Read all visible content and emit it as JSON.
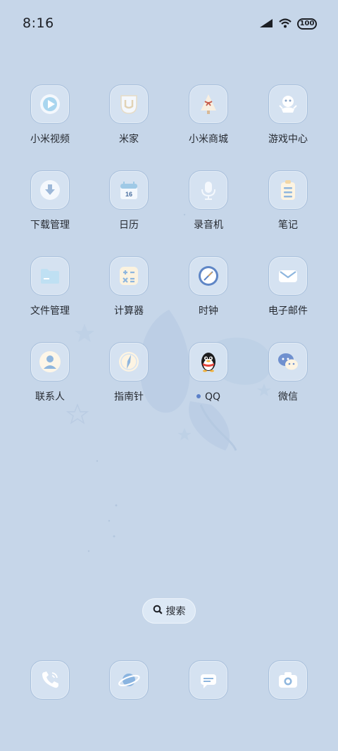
{
  "status_bar": {
    "time": "8:16",
    "battery": "100"
  },
  "apps": [
    {
      "label": "小米视频",
      "icon": "play-icon"
    },
    {
      "label": "米家",
      "icon": "mijia-icon"
    },
    {
      "label": "小米商城",
      "icon": "tree-gift-icon"
    },
    {
      "label": "游戏中心",
      "icon": "game-controller-icon"
    },
    {
      "label": "下载管理",
      "icon": "download-icon"
    },
    {
      "label": "日历",
      "icon": "calendar-icon",
      "day": "16"
    },
    {
      "label": "录音机",
      "icon": "microphone-icon"
    },
    {
      "label": "笔记",
      "icon": "notepad-icon"
    },
    {
      "label": "文件管理",
      "icon": "folder-icon"
    },
    {
      "label": "计算器",
      "icon": "calculator-icon"
    },
    {
      "label": "时钟",
      "icon": "clock-icon"
    },
    {
      "label": "电子邮件",
      "icon": "mail-icon"
    },
    {
      "label": "联系人",
      "icon": "contact-icon"
    },
    {
      "label": "指南针",
      "icon": "compass-icon"
    },
    {
      "label": "QQ",
      "icon": "qq-penguin-icon"
    },
    {
      "label": "微信",
      "icon": "wechat-icon"
    }
  ],
  "search": {
    "label": "搜索",
    "icon": "search-icon"
  },
  "dock": [
    {
      "icon": "phone-icon"
    },
    {
      "icon": "browser-planet-icon"
    },
    {
      "icon": "message-icon"
    },
    {
      "icon": "camera-icon"
    }
  ],
  "colors": {
    "background": "#c6d6e9",
    "icon_border": "#a9c0dc",
    "accent_blue": "#5b80c9"
  }
}
